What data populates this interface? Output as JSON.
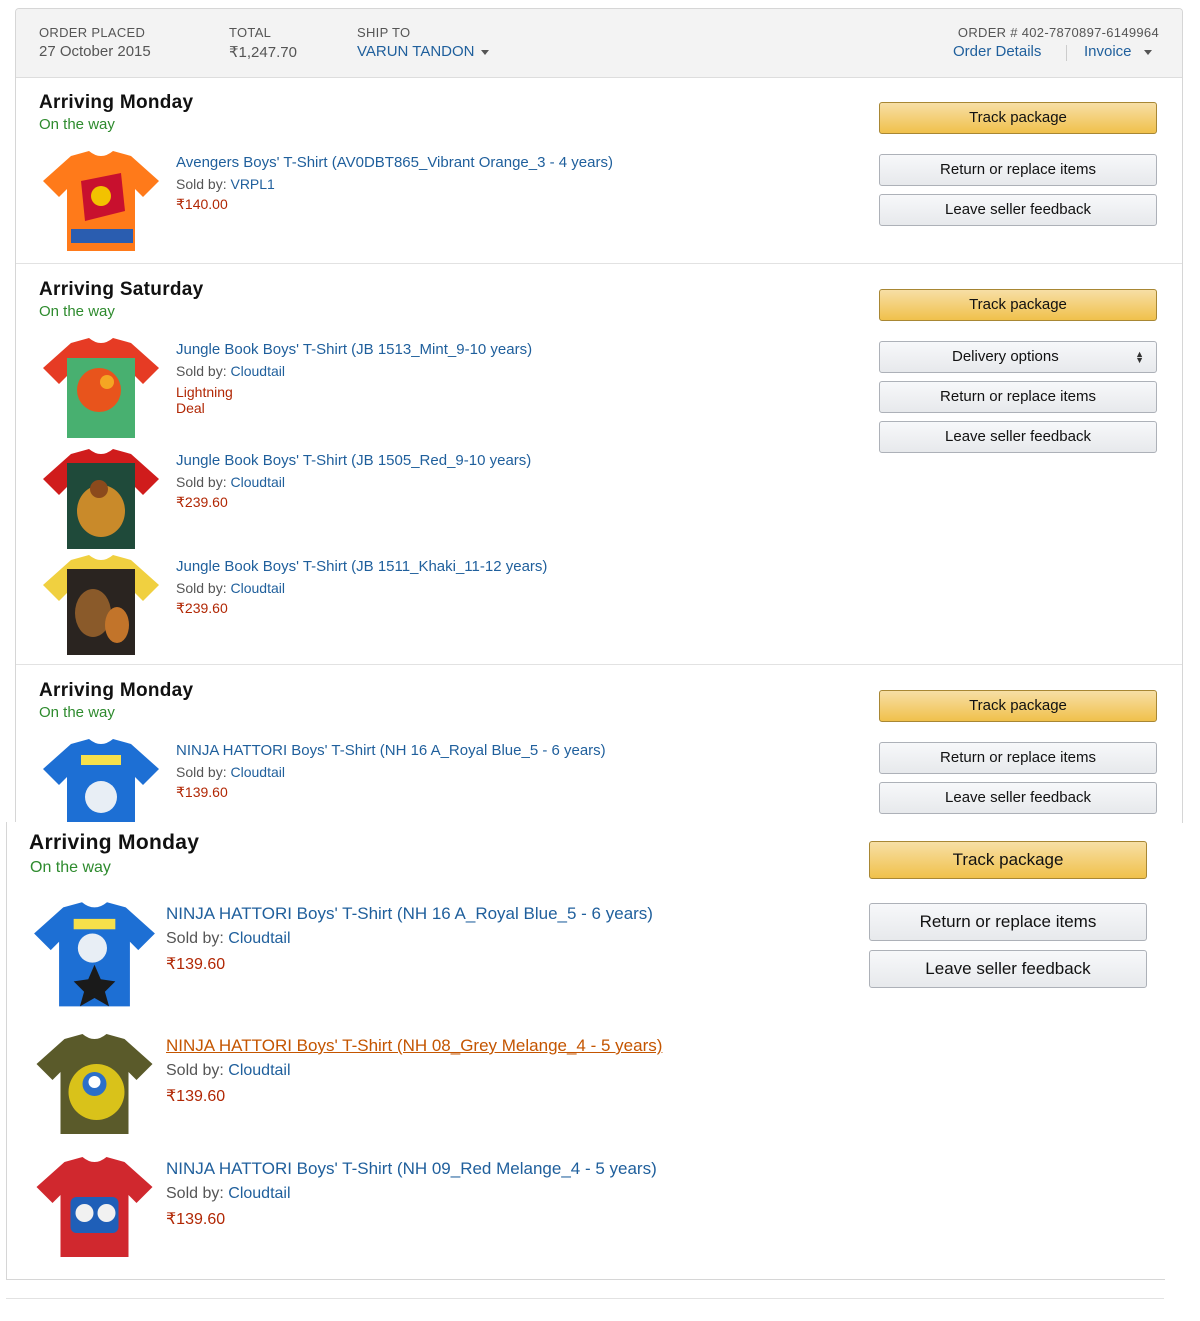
{
  "order_header": {
    "order_placed_label": "ORDER PLACED",
    "order_placed_value": "27 October 2015",
    "total_label": "TOTAL",
    "total_value": "₹1,247.70",
    "ship_to_label": "SHIP TO",
    "ship_to_value": "VARUN TANDON",
    "order_number": "ORDER # 402-7870897-6149964",
    "order_details_link": "Order Details",
    "invoice_link": "Invoice"
  },
  "shipments": [
    {
      "title": "Arriving Monday",
      "status": "On the way",
      "buttons": {
        "track": "Track package",
        "return": "Return or replace items",
        "feedback": "Leave seller feedback"
      },
      "items": [
        {
          "title": "Avengers Boys' T-Shirt (AV0DBT865_Vibrant Orange_3 - 4 years)",
          "sold_by_label": "Sold by:",
          "seller": "VRPL1",
          "price": "₹140.00"
        }
      ]
    },
    {
      "title": "Arriving Saturday",
      "status": "On the way",
      "buttons": {
        "track": "Track package",
        "delivery": "Delivery options",
        "return": "Return or replace items",
        "feedback": "Leave seller feedback"
      },
      "items": [
        {
          "title": "Jungle Book Boys' T-Shirt (JB 1513_Mint_9-10 years)",
          "sold_by_label": "Sold by:",
          "seller": "Cloudtail",
          "deal": "Lightning Deal"
        },
        {
          "title": "Jungle Book Boys' T-Shirt (JB 1505_Red_9-10 years)",
          "sold_by_label": "Sold by:",
          "seller": "Cloudtail",
          "price": "₹239.60"
        },
        {
          "title": "Jungle Book Boys' T-Shirt (JB 1511_Khaki_11-12 years)",
          "sold_by_label": "Sold by:",
          "seller": "Cloudtail",
          "price": "₹239.60"
        }
      ]
    },
    {
      "title": "Arriving Monday",
      "status": "On the way",
      "buttons": {
        "track": "Track package",
        "return": "Return or replace items",
        "feedback": "Leave seller feedback"
      },
      "items": [
        {
          "title": "NINJA HATTORI Boys' T-Shirt (NH 16 A_Royal Blue_5 - 6 years)",
          "sold_by_label": "Sold by:",
          "seller": "Cloudtail",
          "price": "₹139.60"
        }
      ]
    },
    {
      "title": "Arriving Monday",
      "status": "On the way",
      "buttons": {
        "track": "Track package",
        "return": "Return or replace items",
        "feedback": "Leave seller feedback"
      },
      "items": [
        {
          "title": "NINJA HATTORI Boys' T-Shirt (NH 16 A_Royal Blue_5 - 6 years)",
          "sold_by_label": "Sold by:",
          "seller": "Cloudtail",
          "price": "₹139.60"
        },
        {
          "title": "NINJA HATTORI Boys' T-Shirt (NH 08_Grey Melange_4 - 5 years)",
          "sold_by_label": "Sold by:",
          "seller": "Cloudtail",
          "price": "₹139.60"
        },
        {
          "title": "NINJA HATTORI Boys' T-Shirt (NH 09_Red Melange_4 - 5 years)",
          "sold_by_label": "Sold by:",
          "seller": "Cloudtail",
          "price": "₹139.60"
        }
      ]
    }
  ],
  "colors": {
    "link": "#1f5f9c",
    "link_hover": "#c45500",
    "status_green": "#2e8b2e",
    "price_red": "#b12704",
    "track_button": "#f0c14b"
  }
}
